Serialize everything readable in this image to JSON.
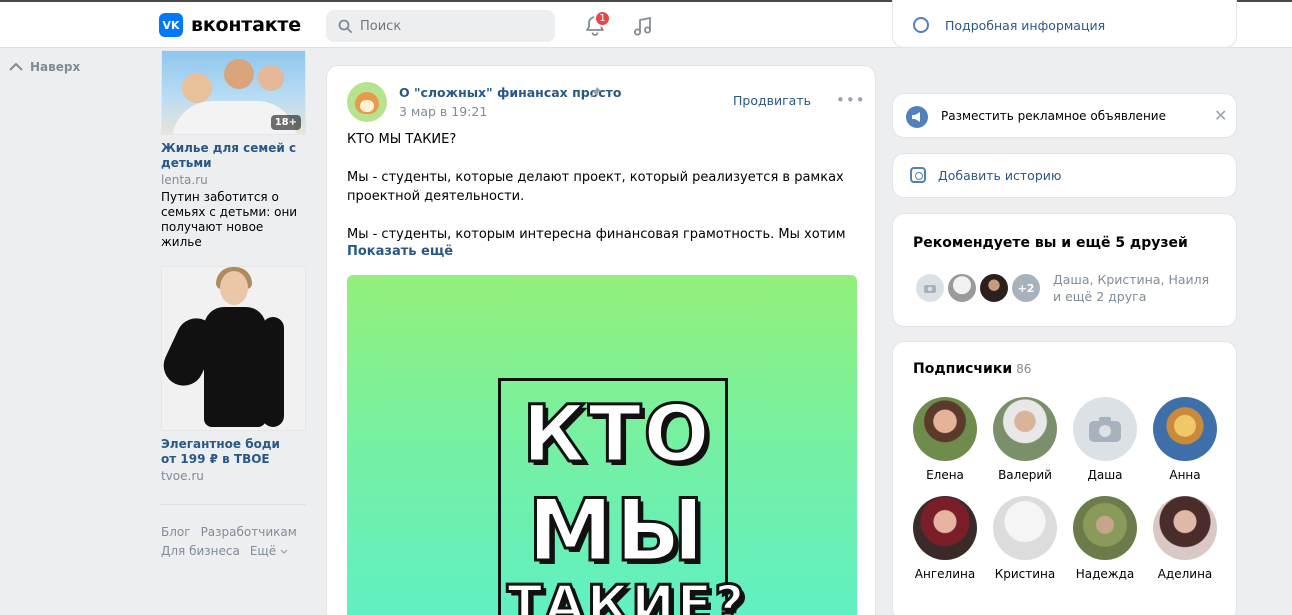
{
  "header": {
    "logo_mark": "VK",
    "logo_text": "вконтакте",
    "search_placeholder": "Поиск",
    "notifications_count": "1",
    "accent_color": "#0077ff",
    "badge_color": "#e64646"
  },
  "left_nav": {
    "back_to_top": "Наверх"
  },
  "ads": [
    {
      "age_badge": "18+",
      "title": "Жилье для семей с детьми",
      "domain": "lenta.ru",
      "description": "Путин заботится о семьях с детьми: они получают новое жилье"
    },
    {
      "title_line1": "Элегантное боди",
      "title_line2": "от 199 ₽ в ТВОЕ",
      "domain": "tvoe.ru"
    }
  ],
  "footer_links": [
    "Блог",
    "Разработчикам",
    "Для бизнеса",
    "Ещё"
  ],
  "post": {
    "author": "О \"сложных\" финансах просто",
    "date": "3 мар в 19:21",
    "promote_label": "Продвигать",
    "text_paragraphs": [
      "КТО МЫ ТАКИЕ?",
      "Мы - студенты, которые делают проект, который реализуется в рамках проектной деятельности.",
      "Мы - студенты, которым интересна финансовая грамотность. Мы хотим"
    ],
    "show_more": "Показать ещё",
    "image_lines": [
      "КТО",
      "МЫ",
      "ТАКИЕ?"
    ]
  },
  "right": {
    "info_link": "Подробная информация",
    "advertise": "Разместить рекламное объявление",
    "add_story": "Добавить историю",
    "recommend_title": "Рекомендуете вы и ещё 5 друзей",
    "recommend_plus": "+2",
    "recommend_names_line1": "Даша, Кристина, Наиля",
    "recommend_names_line2": "и ещё 2 друга",
    "subscribers_title": "Подписчики",
    "subscribers_count": "86",
    "subscribers": [
      {
        "name": "Елена"
      },
      {
        "name": "Валерий"
      },
      {
        "name": "Даша"
      },
      {
        "name": "Анна"
      },
      {
        "name": "Ангелина"
      },
      {
        "name": "Кристина"
      },
      {
        "name": "Надежда"
      },
      {
        "name": "Аделина"
      }
    ]
  }
}
